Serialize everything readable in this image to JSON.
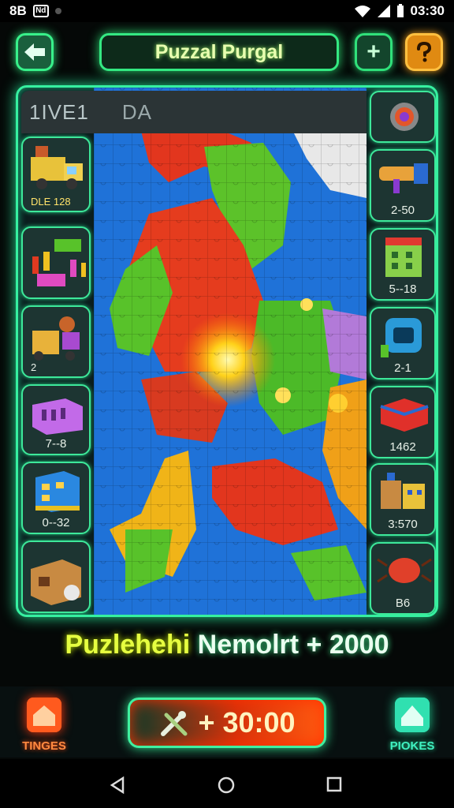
{
  "status_bar": {
    "left_a": "8B",
    "left_b": "Nd",
    "time": "03:30"
  },
  "header": {
    "back_icon": "back-arrow-icon",
    "title": "Puzzal Purgal",
    "plus_label": "+",
    "help_icon": "question-icon"
  },
  "board": {
    "head_left": "1IVE1",
    "head_right": "DA"
  },
  "left_cards": [
    {
      "label": "DLE 128",
      "icon": "truck-icon"
    },
    {
      "label": "",
      "icon": "blocks-icon"
    },
    {
      "label": "2",
      "icon": "forklift-icon"
    },
    {
      "label": "7--8",
      "icon": "purple-box-icon"
    },
    {
      "label": "0--32",
      "icon": "blue-building-icon"
    },
    {
      "label": "",
      "icon": "crate-icon"
    }
  ],
  "right_cards": [
    {
      "label": "",
      "icon": "orb-icon"
    },
    {
      "label": "2-50",
      "icon": "cannon-icon"
    },
    {
      "label": "5--18",
      "icon": "green-building-icon"
    },
    {
      "label": "2-1",
      "icon": "cube-icon"
    },
    {
      "label": "1462",
      "icon": "red-box-icon"
    },
    {
      "label": "3:570",
      "icon": "houses-icon"
    },
    {
      "label": "B6",
      "icon": "beetle-icon"
    }
  ],
  "score": {
    "left": "Puzlehehi",
    "right": "Nemolrt + 2000"
  },
  "bottom": {
    "left_label": "TINGES",
    "timer_value": "+ 30:00",
    "right_label": "PIOKES"
  },
  "colors": {
    "accent": "#36f0a0",
    "orange": "#ff5a1e"
  }
}
